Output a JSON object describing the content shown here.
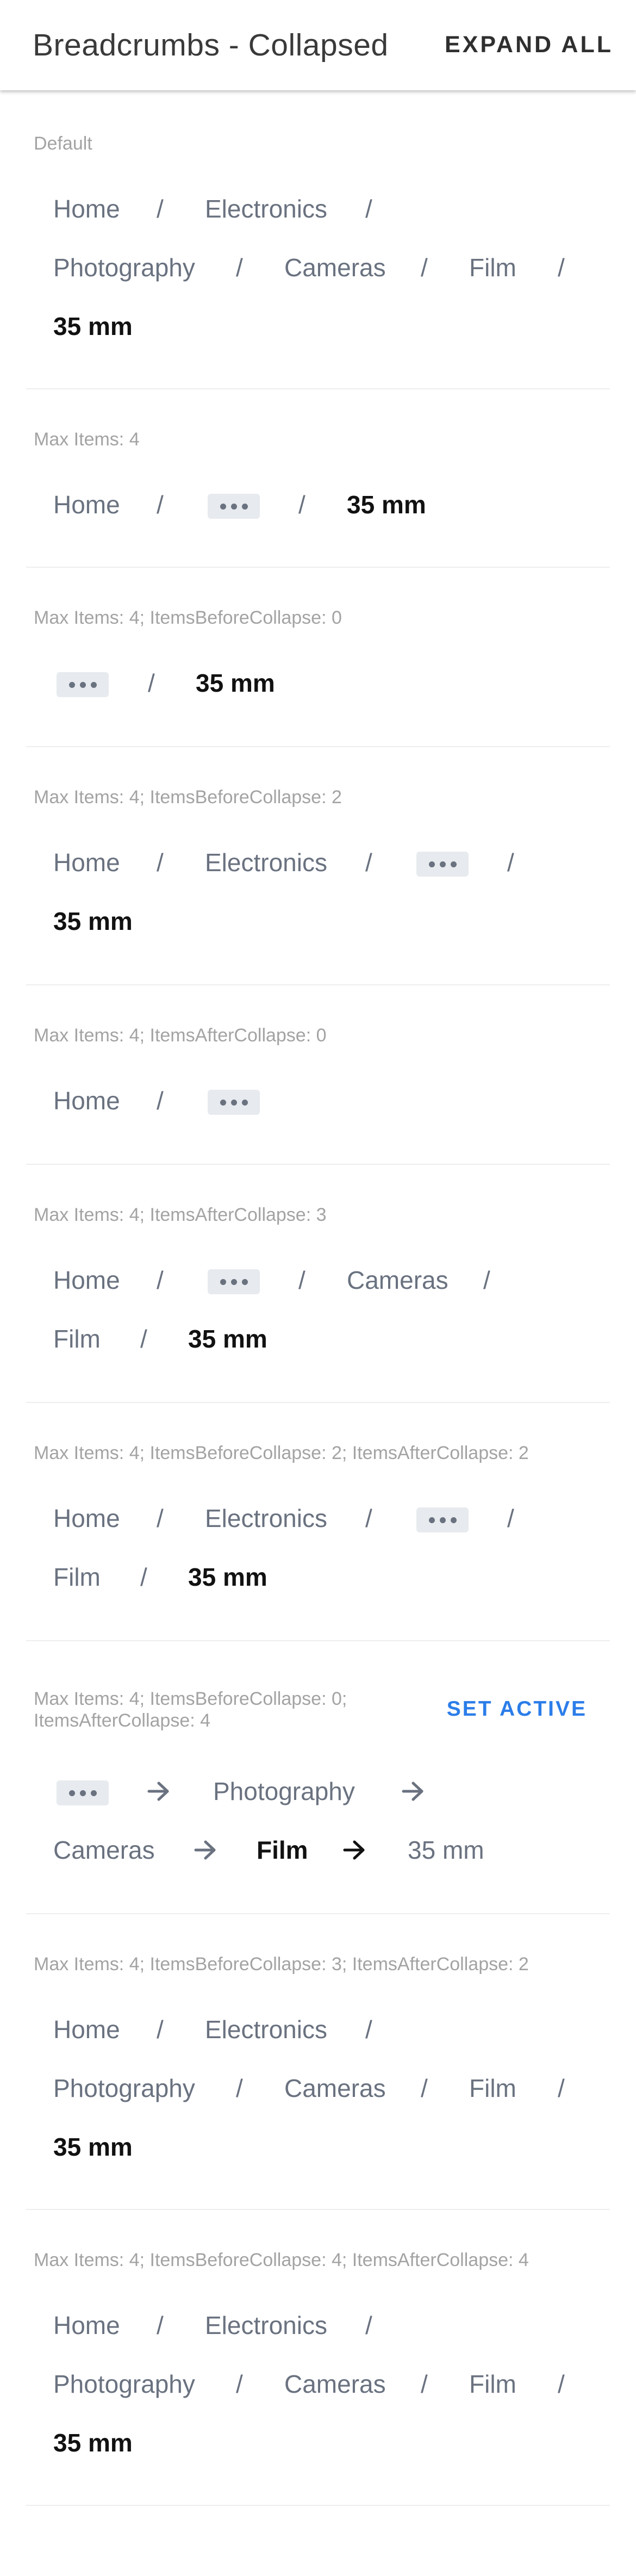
{
  "appbar": {
    "title": "Breadcrumbs - Collapsed",
    "expand_all": "EXPAND ALL"
  },
  "crumb": {
    "home": "Home",
    "electronics": "Electronics",
    "photography": "Photography",
    "cameras": "Cameras",
    "film": "Film",
    "mm35": "35 mm",
    "slash": "/"
  },
  "sections": [
    {
      "caption": "Default"
    },
    {
      "caption": "Max Items: 4"
    },
    {
      "caption": "Max Items: 4; ItemsBeforeCollapse: 0"
    },
    {
      "caption": "Max Items: 4; ItemsBeforeCollapse: 2"
    },
    {
      "caption": "Max Items: 4; ItemsAfterCollapse: 0"
    },
    {
      "caption": "Max Items: 4; ItemsAfterCollapse: 3"
    },
    {
      "caption": "Max Items: 4; ItemsBeforeCollapse: 2; ItemsAfterCollapse: 2"
    },
    {
      "caption_line1": "Max Items: 4; ItemsBeforeCollapse: 0;",
      "caption_line2": "ItemsAfterCollapse: 4",
      "action": "SET ACTIVE"
    },
    {
      "caption": "Max Items: 4; ItemsBeforeCollapse: 3; ItemsAfterCollapse: 2"
    },
    {
      "caption": "Max Items: 4; ItemsBeforeCollapse: 4; ItemsAfterCollapse: 4"
    }
  ],
  "icons": {
    "collapse": "more-horiz-icon",
    "separator_arrow": "arrow-forward-icon"
  },
  "colors": {
    "link": "#6a7280",
    "current": "#111111",
    "action": "#2b7de9",
    "caption": "#a3a3a3"
  }
}
